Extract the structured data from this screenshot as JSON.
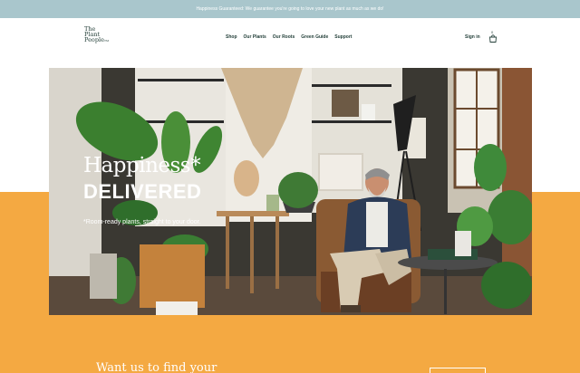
{
  "announcement": {
    "text": "Happiness Guaranteed: We guarantee you're going to love your new plant as much as we do!"
  },
  "brand": {
    "line1": "The",
    "line2": "Plant",
    "line3": "People",
    "tm": "TM"
  },
  "nav": {
    "items": [
      {
        "label": "Shop"
      },
      {
        "label": "Our Plants"
      },
      {
        "label": "Our Roots"
      },
      {
        "label": "Green Guide"
      },
      {
        "label": "Support"
      }
    ]
  },
  "account": {
    "signin_label": "Sign in",
    "cart_count": "0",
    "cart_icon": "shopping-bag-icon"
  },
  "hero": {
    "title_line1": "Happiness*",
    "title_line2": "DELIVERED",
    "subtitle": "*Room-ready plants, straight to your door."
  },
  "teaser": {
    "text": "Want us to find your"
  },
  "colors": {
    "announcement_bg": "#a9c6cc",
    "accent_orange": "#f4a942",
    "text_dark": "#24403a"
  }
}
